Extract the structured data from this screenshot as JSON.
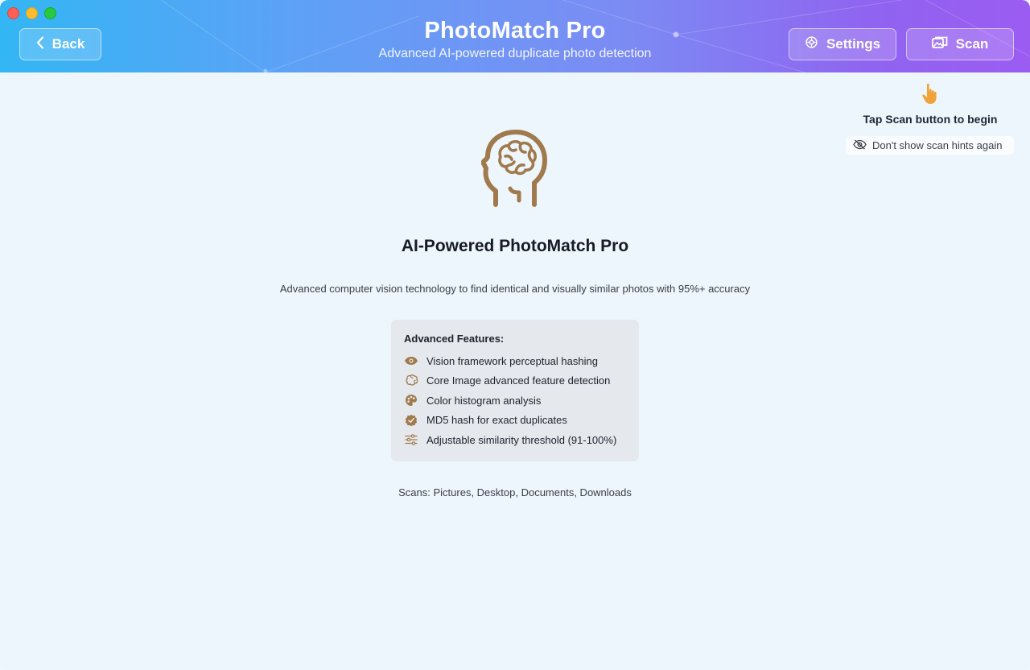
{
  "header": {
    "title": "PhotoMatch Pro",
    "subtitle": "Advanced AI-powered duplicate photo detection",
    "back_label": "Back",
    "settings_label": "Settings",
    "scan_label": "Scan"
  },
  "hint": {
    "text": "Tap Scan button to begin",
    "toggle_label": "Don't show scan hints again"
  },
  "main": {
    "title": "AI-Powered PhotoMatch Pro",
    "description": "Advanced computer vision technology to find identical and visually similar photos with 95%+ accuracy",
    "features_title": "Advanced Features:",
    "features": [
      {
        "icon": "eye-icon",
        "label": "Vision framework perceptual hashing"
      },
      {
        "icon": "brain-icon",
        "label": "Core Image advanced feature detection"
      },
      {
        "icon": "palette-icon",
        "label": "Color histogram analysis"
      },
      {
        "icon": "checkmark-seal-icon",
        "label": "MD5 hash for exact duplicates"
      },
      {
        "icon": "sliders-icon",
        "label": "Adjustable similarity threshold (91-100%)"
      }
    ],
    "scans_text": "Scans: Pictures, Desktop, Documents, Downloads"
  },
  "colors": {
    "accent_brown": "#a07a4c",
    "hint_hand": "#f0a33a",
    "header_gradient_start": "#33b6f4",
    "header_gradient_end": "#9b5cf2"
  }
}
